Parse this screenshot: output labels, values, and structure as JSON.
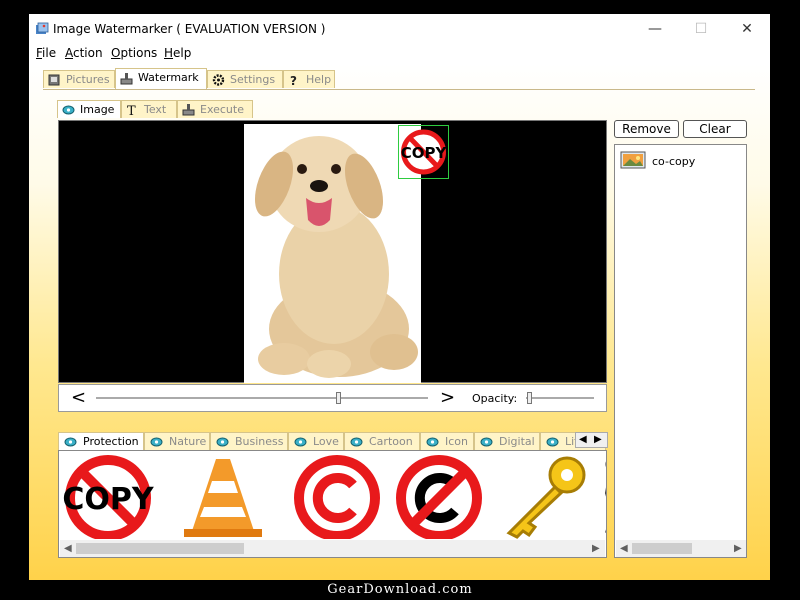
{
  "window": {
    "title": "Image Watermarker ( EVALUATION VERSION )",
    "minimize": "—",
    "maximize": "☐",
    "close": "✕"
  },
  "menu": {
    "items": [
      "File",
      "Action",
      "Options",
      "Help"
    ],
    "underline": [
      "F",
      "A",
      "O",
      "H"
    ]
  },
  "main_tabs": [
    {
      "label": "Pictures",
      "icon": "pictures-icon"
    },
    {
      "label": "Watermark",
      "icon": "watermark-icon"
    },
    {
      "label": "Settings",
      "icon": "gear-icon"
    },
    {
      "label": "Help",
      "icon": "question-icon"
    }
  ],
  "sub_tabs": [
    {
      "label": "Image",
      "icon": "image-icon"
    },
    {
      "label": "Text",
      "icon": "text-icon"
    },
    {
      "label": "Execute",
      "icon": "execute-icon"
    }
  ],
  "preview": {
    "prev_arrow": "<",
    "next_arrow": ">",
    "opacity_label": "Opacity:",
    "position_value": 0.73,
    "opacity_value": 0.05
  },
  "watermark_text": "COPY",
  "buttons": {
    "remove": "Remove",
    "clear": "Clear"
  },
  "file_list": [
    {
      "name": "co-copy"
    }
  ],
  "categories": [
    "Protection",
    "Nature",
    "Business",
    "Love",
    "Cartoon",
    "Icon",
    "Digital",
    "Lif"
  ],
  "gallery": [
    {
      "name": "copy-symbol",
      "text": "COPY"
    },
    {
      "name": "traffic-cone"
    },
    {
      "name": "copyright-symbol"
    },
    {
      "name": "no-copyright-symbol"
    },
    {
      "name": "gold-key"
    }
  ],
  "footer": {
    "caption": "GearDownload.com"
  },
  "colors": {
    "accent_red": "#e8191b",
    "selection": "#2ecc40",
    "tab_bg": "#fff4c8",
    "client_bottom": "#ffd24a"
  }
}
